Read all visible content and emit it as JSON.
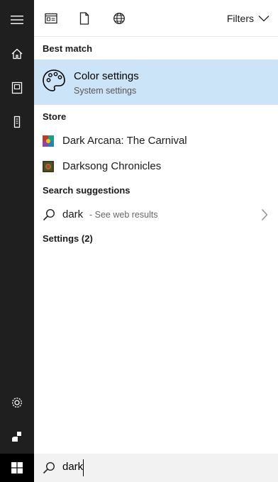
{
  "rail": {
    "icons": [
      "hamburger-icon",
      "home-icon",
      "documents-icon",
      "device-icon",
      "settings-gear-icon",
      "user-icon",
      "windows-logo-icon"
    ]
  },
  "topbar": {
    "filters_label": "Filters"
  },
  "best_match": {
    "heading": "Best match",
    "title": "Color settings",
    "subtitle": "System settings"
  },
  "store": {
    "heading": "Store",
    "items": [
      {
        "label": "Dark Arcana: The Carnival"
      },
      {
        "label": "Darksong Chronicles"
      }
    ]
  },
  "suggestions": {
    "heading": "Search suggestions",
    "query": "dark",
    "see_web": "- See web results"
  },
  "settings_group": {
    "heading": "Settings (2)"
  },
  "searchbox": {
    "value": "dark"
  },
  "colors": {
    "rail": "#1f1f1f",
    "highlight": "#cce4f7",
    "searchbar": "#f2f2f2"
  }
}
